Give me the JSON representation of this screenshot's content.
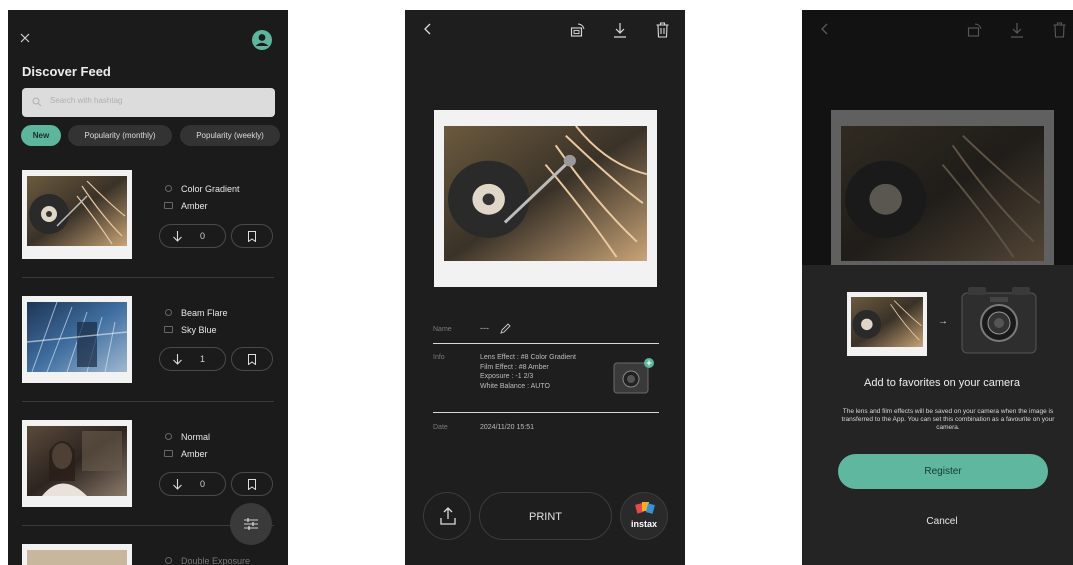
{
  "feed": {
    "title": "Discover Feed",
    "search_placeholder": "Search with hashtag",
    "filters": [
      "New",
      "Popularity (monthly)",
      "Popularity (weekly)"
    ],
    "items": [
      {
        "lens": "Color Gradient",
        "film": "Amber",
        "downloads": "0"
      },
      {
        "lens": "Beam Flare",
        "film": "Sky Blue",
        "downloads": "1"
      },
      {
        "lens": "Normal",
        "film": "Amber",
        "downloads": "0"
      },
      {
        "lens": "Double Exposure",
        "film": ""
      }
    ]
  },
  "detail": {
    "name_label": "Name",
    "name_value": "---",
    "info_label": "Info",
    "info_lines": [
      "Lens Effect : #8 Color Gradient",
      "Film Effect : #8 Amber",
      "Exposure : -1 2/3",
      "White Balance : AUTO"
    ],
    "date_label": "Date",
    "date_value": "2024/11/20 15:51",
    "print_label": "PRINT",
    "brand_label": "instax"
  },
  "favorite_sheet": {
    "title": "Add to favorites on your camera",
    "description": "The lens and film effects will be saved on your camera when the image is transferred to the App. You can set this combination as a favourite on your camera.",
    "register_label": "Register",
    "cancel_label": "Cancel",
    "arrow": "→"
  },
  "colors": {
    "accent": "#5fb7a0",
    "background": "#1b1b1b"
  }
}
